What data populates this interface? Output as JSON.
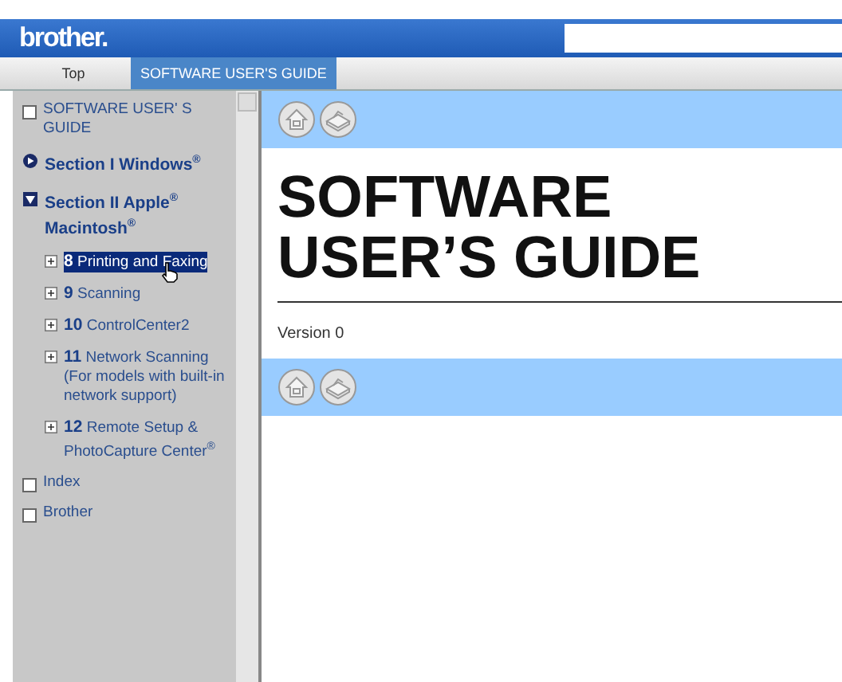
{
  "header": {
    "logo": "brother."
  },
  "tabs": [
    {
      "label": "Top",
      "selected": false
    },
    {
      "label": "SOFTWARE USER'S GUIDE",
      "selected": true
    }
  ],
  "sidebar": {
    "items": [
      {
        "kind": "page",
        "label": "SOFTWARE USER' S GUIDE",
        "selected": false
      },
      {
        "kind": "section",
        "label": "Section I Windows$^{®}$",
        "expanded": false,
        "selected": false
      },
      {
        "kind": "section",
        "label": "Section II Apple$^{®}$ Macintosh$^{®}$",
        "expanded": true,
        "selected": false,
        "children": [
          {
            "kind": "chapter",
            "label": "**8** Printing and Faxing",
            "selected": true
          },
          {
            "kind": "chapter",
            "label": "**9** Scanning",
            "selected": false
          },
          {
            "kind": "chapter",
            "label": "**10** ControlCenter2",
            "selected": false
          },
          {
            "kind": "chapter",
            "label": "**11** Network Scanning (For models with built-in network support)",
            "selected": false
          },
          {
            "kind": "chapter",
            "label": "**12** Remote Setup & PhotoCapture Center$^{®}$",
            "selected": false
          }
        ]
      },
      {
        "kind": "page",
        "label": "Index",
        "selected": false
      },
      {
        "kind": "page",
        "label": "Brother",
        "selected": false
      }
    ]
  },
  "content": {
    "title": "SOFTWARE USER’S GUIDE",
    "version": "Version 0"
  }
}
